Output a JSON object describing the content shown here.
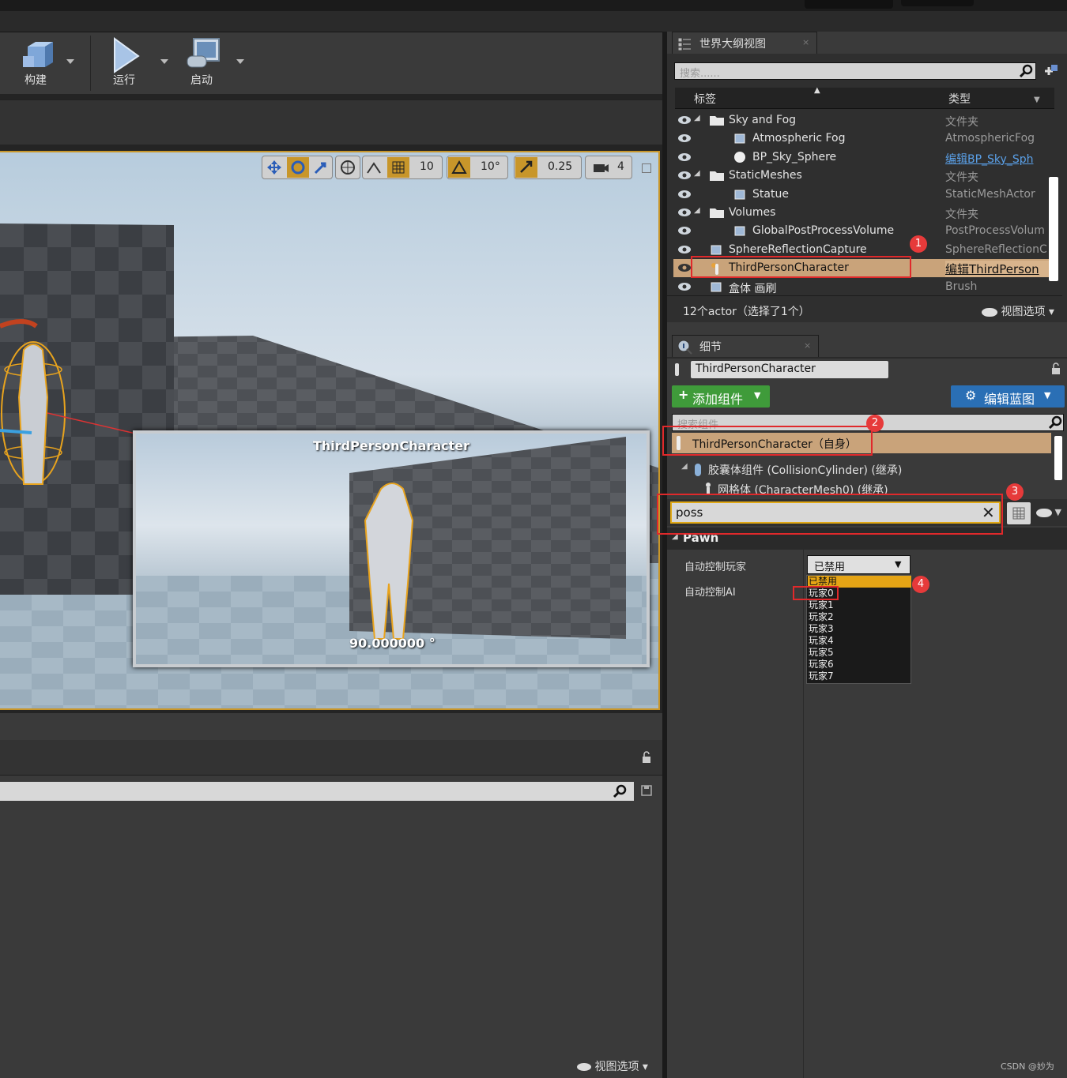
{
  "toolbar": {
    "build_label": "构建",
    "play_label": "运行",
    "launch_label": "启动"
  },
  "viewport": {
    "toolbar": {
      "grid_snap": "10",
      "rotation_snap": "10°",
      "scale_snap": "0.25",
      "camera_speed": "4"
    },
    "preview_title": "ThirdPersonCharacter",
    "preview_angle": "90.000000 °"
  },
  "outliner": {
    "tab_title": "世界大纲视图",
    "search_placeholder": "搜索......",
    "col_label": "标签",
    "col_type": "类型",
    "rows": [
      {
        "name": "Sky and Fog",
        "type": "文件夹",
        "icon": "folder-icon"
      },
      {
        "name": "Atmospheric Fog",
        "type": "AtmosphericFog",
        "icon": "fog-icon"
      },
      {
        "name": "BP_Sky_Sphere",
        "type": "编辑BP_Sky_Sph",
        "icon": "sphere-icon"
      },
      {
        "name": "StaticMeshes",
        "type": "文件夹",
        "icon": "folder-icon"
      },
      {
        "name": "Statue",
        "type": "StaticMeshActor",
        "icon": "mesh-icon"
      },
      {
        "name": "Volumes",
        "type": "文件夹",
        "icon": "folder-icon"
      },
      {
        "name": "GlobalPostProcessVolume",
        "type": "PostProcessVolum",
        "icon": "volume-icon"
      },
      {
        "name": "SphereReflectionCapture",
        "type": "SphereReflectionC",
        "icon": "capture-icon"
      },
      {
        "name": "ThirdPersonCharacter",
        "type": "编辑ThirdPerson",
        "icon": "pawn-icon"
      },
      {
        "name": "盒体 画刷",
        "type": "Brush",
        "icon": "brush-icon"
      }
    ],
    "status": "12个actor（选择了1个）",
    "view_options": "视图选项"
  },
  "details": {
    "tab_title": "细节",
    "actor_name": "ThirdPersonCharacter",
    "add_component": "添加组件",
    "edit_blueprint": "编辑蓝图",
    "search_components_placeholder": "搜索组件",
    "components": [
      "ThirdPersonCharacter（自身）",
      "胶囊体组件 (CollisionCylinder) (继承)",
      "网格体 (CharacterMesh0) (继承)"
    ],
    "filter_value": "poss",
    "section": "Pawn",
    "prop_auto_possess_player": "自动控制玩家",
    "prop_auto_possess_ai": "自动控制AI",
    "selected_value": "已禁用",
    "dropdown_options": [
      "已禁用",
      "玩家0",
      "玩家1",
      "玩家2",
      "玩家3",
      "玩家4",
      "玩家5",
      "玩家6",
      "玩家7"
    ]
  },
  "annotations": [
    "1",
    "2",
    "3",
    "4"
  ],
  "bottom": {
    "view_options": "视图选项"
  },
  "watermark": "CSDN @妙为",
  "colors": {
    "accent_orange": "#c8962a",
    "selection": "#c9a37a",
    "annotation_red": "#e0292b",
    "add_green": "#3f9b3a",
    "edit_blue": "#2a6fb5"
  }
}
